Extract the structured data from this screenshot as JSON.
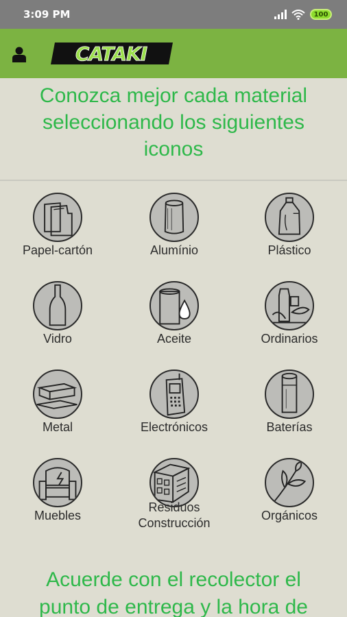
{
  "status_bar": {
    "time": "3:09 PM",
    "battery": "100",
    "icons": [
      "signal-icon",
      "wifi-icon",
      "battery-icon"
    ]
  },
  "app_bar": {
    "logo_text": "CATAKI",
    "icons": [
      "user-icon"
    ]
  },
  "intro": {
    "line1": "Conozca mejor cada material",
    "line2": "seleccionando los siguientes",
    "line3": "iconos"
  },
  "materials": [
    {
      "label": "Papel-cartón",
      "icon": "paper-icon"
    },
    {
      "label": "Alumínio",
      "icon": "can-icon"
    },
    {
      "label": "Plástico",
      "icon": "plastic-bottle-icon"
    },
    {
      "label": "Vidro",
      "icon": "glass-bottle-icon"
    },
    {
      "label": "Aceite",
      "icon": "oil-icon"
    },
    {
      "label": "Ordinarios",
      "icon": "ordinary-waste-icon"
    },
    {
      "label": "Metal",
      "icon": "metal-icon"
    },
    {
      "label": "Electrónicos",
      "icon": "phone-icon"
    },
    {
      "label": "Baterías",
      "icon": "battery-cell-icon"
    },
    {
      "label": "Muebles",
      "icon": "furniture-icon"
    },
    {
      "label": "Residuos",
      "label2": "Construcción",
      "icon": "construction-icon"
    },
    {
      "label": "Orgánicos",
      "icon": "leaf-icon"
    }
  ],
  "bottom": {
    "line1": "Acuerde con el recolector el",
    "line2": "punto de entrega y la hora de"
  },
  "colors": {
    "app_bar": "#7cb342",
    "accent_text": "#2eb84a",
    "background": "#deddd1",
    "status_bar": "#7d7d7d"
  }
}
